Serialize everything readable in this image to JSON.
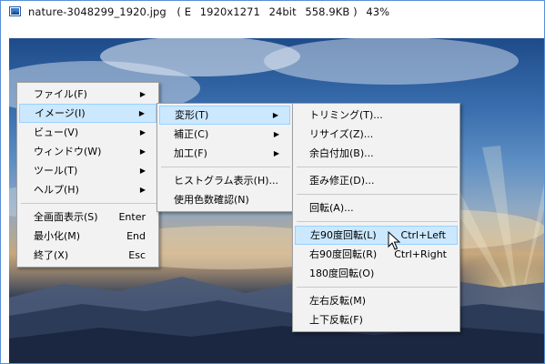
{
  "window": {
    "title": "nature-3048299_1920.jpg　( E  1920x1271  24bit  558.9KB )  43%"
  },
  "main_menu": {
    "items": [
      {
        "label": "ファイル(F)",
        "has_submenu": true
      },
      {
        "label": "イメージ(I)",
        "has_submenu": true
      },
      {
        "label": "ビュー(V)",
        "has_submenu": true
      },
      {
        "label": "ウィンドウ(W)",
        "has_submenu": true
      },
      {
        "label": "ツール(T)",
        "has_submenu": true
      },
      {
        "label": "ヘルプ(H)",
        "has_submenu": true
      }
    ],
    "extra": [
      {
        "label": "全画面表示(S)",
        "shortcut": "Enter"
      },
      {
        "label": "最小化(M)",
        "shortcut": "End"
      },
      {
        "label": "終了(X)",
        "shortcut": "Esc"
      }
    ]
  },
  "image_menu": {
    "items": [
      {
        "label": "変形(T)",
        "has_submenu": true
      },
      {
        "label": "補正(C)",
        "has_submenu": true
      },
      {
        "label": "加工(F)",
        "has_submenu": true
      }
    ],
    "extra": [
      {
        "label": "ヒストグラム表示(H)..."
      },
      {
        "label": "使用色数確認(N)"
      }
    ]
  },
  "transform_menu": {
    "group1": [
      {
        "label": "トリミング(T)..."
      },
      {
        "label": "リサイズ(Z)..."
      },
      {
        "label": "余白付加(B)..."
      }
    ],
    "group2": [
      {
        "label": "歪み修正(D)..."
      }
    ],
    "group3": [
      {
        "label": "回転(A)..."
      }
    ],
    "group4": [
      {
        "label": "左90度回転(L)",
        "shortcut": "Ctrl+Left"
      },
      {
        "label": "右90度回転(R)",
        "shortcut": "Ctrl+Right"
      },
      {
        "label": "180度回転(O)"
      }
    ],
    "group5": [
      {
        "label": "左右反転(M)"
      },
      {
        "label": "上下反転(F)"
      }
    ]
  },
  "colors": {
    "highlight_bg": "#cce8ff",
    "highlight_border": "#99d1ff",
    "menu_bg": "#f2f2f2",
    "window_border": "#5a8fd8"
  }
}
